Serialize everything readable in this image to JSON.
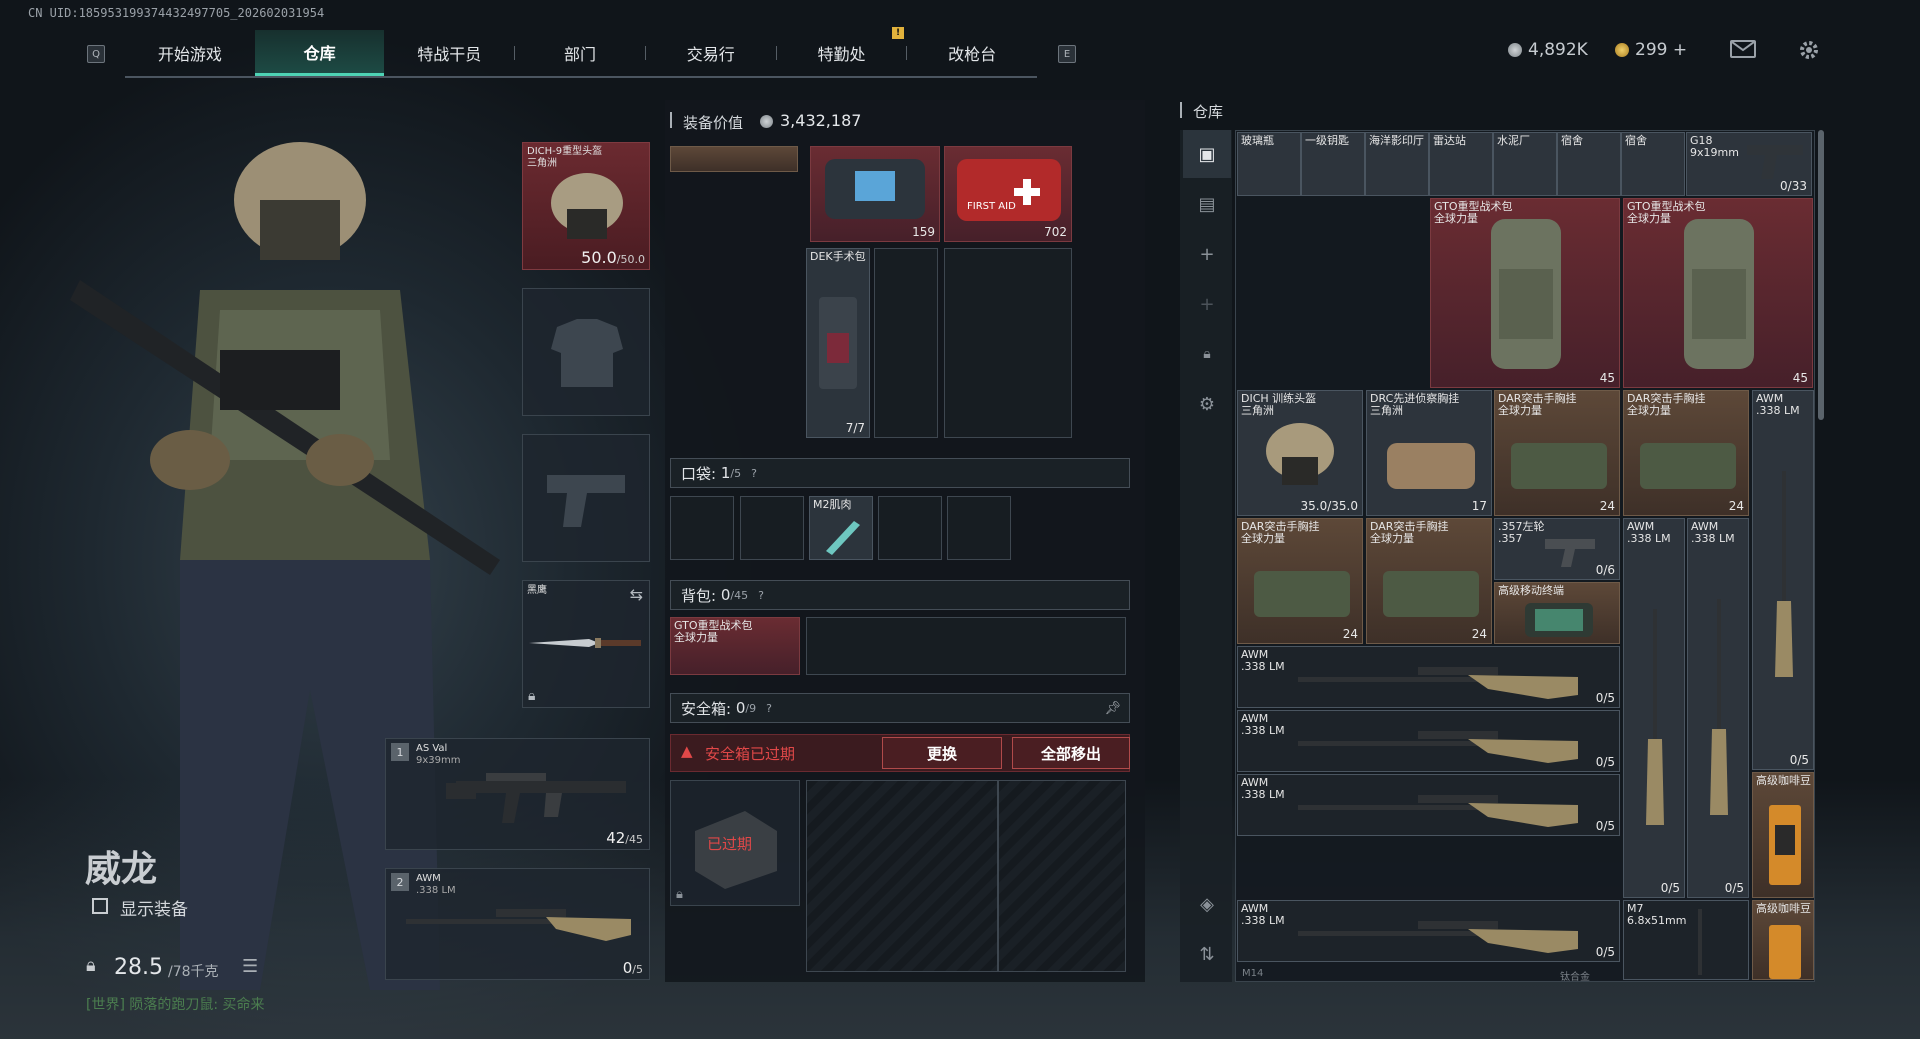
{
  "uid": "CN UID:185953199374432497705_202602031954",
  "nav": {
    "left_key": "Q",
    "right_key": "E",
    "notification": "!",
    "tabs": [
      "开始游戏",
      "仓库",
      "特战干员",
      "部门",
      "交易行",
      "特勤处",
      "改枪台"
    ]
  },
  "currency": {
    "silver": "4,892K",
    "gold": "299 +"
  },
  "colors": {
    "accent": "#4ed3b5",
    "danger": "#e04848",
    "gold": "#d6a63c"
  },
  "operator": {
    "name": "威龙",
    "show_gear_label": "显示装备",
    "weight": "28.5",
    "weight_max": "/78千克",
    "chat": "[世界] 陨落的跑刀鼠: 买命来"
  },
  "equip": {
    "helmet": {
      "name": "DICH-9重型头盔",
      "sub": "三角洲",
      "durability": "50.0",
      "durability_max": "/50.0"
    },
    "melee": {
      "name": "黑鹰"
    },
    "primary": {
      "slot": "1",
      "name": "AS Val",
      "caliber": "9x39mm",
      "ammo": "42",
      "ammo_max": "/45"
    },
    "secondary": {
      "slot": "2",
      "name": "AWM",
      "caliber": ".338 LM",
      "ammo": "0",
      "ammo_max": "/5"
    }
  },
  "middle": {
    "value_label": "装备价值",
    "value": "3,432,187",
    "rig_items": [
      {
        "count": "159"
      },
      {
        "count": "702",
        "name": "FIRST AID"
      }
    ],
    "medkit": {
      "name": "DEK手术包",
      "count": "7/7"
    },
    "pockets": {
      "label": "口袋:",
      "count": "1",
      "max": "/5",
      "help": "?",
      "item": "M2肌肉"
    },
    "backpack": {
      "label": "背包:",
      "count": "0",
      "max": "/45",
      "help": "?",
      "item": "GTO重型战术包",
      "item_sub": "全球力量"
    },
    "safebox": {
      "label": "安全箱:",
      "count": "0",
      "max": "/9",
      "help": "?",
      "expired_text": "安全箱已过期",
      "replace_btn": "更换",
      "moveall_btn": "全部移出",
      "expired_badge": "已过期"
    }
  },
  "warehouse": {
    "title": "仓库",
    "top_row": [
      "玻璃瓶",
      "一级钥匙",
      "海洋影印厅",
      "雷达站",
      "水泥厂",
      "宿舍",
      "宿舍",
      "G18"
    ],
    "g18_caliber": "9x19mm",
    "g18_count": "0/33",
    "items": [
      {
        "key": "gto1",
        "name": "GTO重型战术包",
        "sub": "全球力量",
        "count": "45"
      },
      {
        "key": "gto2",
        "name": "GTO重型战术包",
        "sub": "全球力量",
        "count": "45"
      },
      {
        "key": "dich",
        "name": "DICH 训练头盔",
        "sub": "三角洲",
        "count": "35.0/35.0"
      },
      {
        "key": "drc",
        "name": "DRC先进侦察胸挂",
        "sub": "三角洲",
        "count": "17"
      },
      {
        "key": "dar1",
        "name": "DAR突击手胸挂",
        "sub": "全球力量",
        "count": "24"
      },
      {
        "key": "dar2",
        "name": "DAR突击手胸挂",
        "sub": "全球力量",
        "count": "24"
      },
      {
        "key": "dar3",
        "name": "DAR突击手胸挂",
        "sub": "全球力量",
        "count": "24"
      },
      {
        "key": "dar4",
        "name": "DAR突击手胸挂",
        "sub": "全球力量",
        "count": "24"
      },
      {
        "key": "rev",
        "name": ".357左轮",
        "sub": ".357",
        "count": "0/6"
      },
      {
        "key": "case",
        "name": "高级移动终端",
        "sub": "",
        "count": ""
      },
      {
        "key": "awm_v1",
        "name": "AWM",
        "sub": ".338 LM",
        "count": "0/5"
      },
      {
        "key": "awm_v2",
        "name": "AWM",
        "sub": ".338 LM",
        "count": "0/5"
      },
      {
        "key": "awm_v3",
        "name": "AWM",
        "sub": ".338 LM",
        "count": "0/5"
      },
      {
        "key": "awm_h1",
        "name": "AWM",
        "sub": ".338 LM",
        "count": "0/5"
      },
      {
        "key": "awm_h2",
        "name": "AWM",
        "sub": ".338 LM",
        "count": "0/5"
      },
      {
        "key": "awm_h3",
        "name": "AWM",
        "sub": ".338 LM",
        "count": "0/5"
      },
      {
        "key": "awm_h4",
        "name": "AWM",
        "sub": ".338 LM",
        "count": "0/5"
      },
      {
        "key": "coffee1",
        "name": "高级咖啡豆",
        "sub": "",
        "count": ""
      },
      {
        "key": "coffee2",
        "name": "高级咖啡豆",
        "sub": "",
        "count": ""
      },
      {
        "key": "m7",
        "name": "M7",
        "sub": "6.8x51mm",
        "count": ""
      }
    ],
    "extra_counts": [
      "0/5",
      "0/5"
    ],
    "bottom_labels": [
      "M14",
      "钛合金"
    ]
  }
}
